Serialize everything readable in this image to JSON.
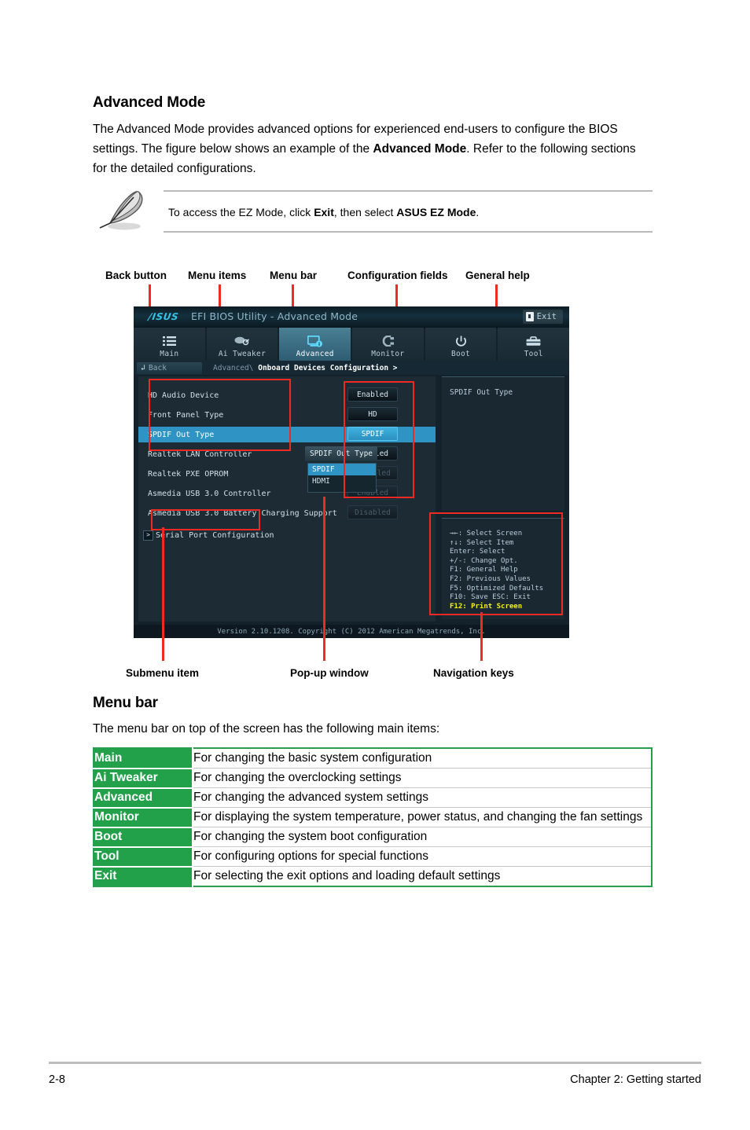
{
  "section": {
    "title": "Advanced Mode",
    "paragraph_1": "The Advanced Mode provides advanced options for experienced end-users to configure the BIOS settings. The figure below shows an example of the ",
    "paragraph_1_bold": "Advanced Mode",
    "paragraph_1_tail": ". Refer to the following sections for the detailed configurations."
  },
  "note": {
    "icon": "pencil-icon",
    "text_before": "To access the EZ Mode, click ",
    "bold_1": "Exit",
    "text_middle": ", then select ",
    "bold_2": "ASUS EZ Mode",
    "text_after": "."
  },
  "callouts": {
    "top": [
      {
        "label": "Back button"
      },
      {
        "label": "Menu items"
      },
      {
        "label": "Menu bar"
      },
      {
        "label": "Configuration fields"
      },
      {
        "label": "General help"
      }
    ],
    "bottom": [
      {
        "label": "Submenu item"
      },
      {
        "label": "Pop-up window"
      },
      {
        "label": "Navigation keys"
      }
    ],
    "line_color": "#ee2b22"
  },
  "bios": {
    "logo_text": "/ISUS",
    "title": "EFI BIOS Utility - Advanced Mode",
    "exit_label": "Exit",
    "exit_icon": "exit-door-icon",
    "tabs": [
      {
        "label": "Main",
        "icon": "list-icon",
        "active": false
      },
      {
        "label": "Ai Tweaker",
        "icon": "tuner-icon",
        "active": false
      },
      {
        "label": "Advanced",
        "icon": "monitor-info-icon",
        "active": true
      },
      {
        "label": "Monitor",
        "icon": "gauge-icon",
        "active": false
      },
      {
        "label": "Boot",
        "icon": "power-icon",
        "active": false
      },
      {
        "label": "Tool",
        "icon": "toolbox-icon",
        "active": false
      }
    ],
    "back_label": "Back",
    "back_icon": "back-arrow-icon",
    "breadcrumb_prefix": "Advanced\\",
    "breadcrumb_current": "Onboard Devices Configuration >",
    "options": [
      {
        "name": "HD Audio Device",
        "value": "Enabled",
        "state": "normal",
        "selected": false
      },
      {
        "name": "Front Panel Type",
        "value": "HD",
        "state": "normal",
        "selected": false
      },
      {
        "name": "SPDIF Out Type",
        "value": "SPDIF",
        "state": "active",
        "selected": true
      },
      {
        "name": "Realtek LAN Controller",
        "value": "Enabled",
        "state": "normal",
        "selected": false
      },
      {
        "name": "Realtek PXE OPROM",
        "value": "Disabled",
        "state": "dim",
        "selected": false
      },
      {
        "name": "Asmedia USB 3.0 Controller",
        "value": "Enabled",
        "state": "dim",
        "selected": false
      },
      {
        "name": "Asmedia USB 3.0 Battery Charging Support",
        "value": "Disabled",
        "state": "dim",
        "selected": false
      }
    ],
    "submenu": {
      "label": "Serial Port Configuration",
      "icon": "submenu-arrow-icon"
    },
    "popup": {
      "title": "SPDIF Out Type",
      "items": [
        {
          "label": "SPDIF",
          "selected": true
        },
        {
          "label": "HDMI",
          "selected": false
        }
      ]
    },
    "help": {
      "text": "SPDIF Out Type"
    },
    "navigation_keys": [
      {
        "text": "→←: Select Screen",
        "highlight": false
      },
      {
        "text": "↑↓: Select Item",
        "highlight": false
      },
      {
        "text": "Enter: Select",
        "highlight": false
      },
      {
        "text": "+/-: Change Opt.",
        "highlight": false
      },
      {
        "text": "F1: General Help",
        "highlight": false
      },
      {
        "text": "F2: Previous Values",
        "highlight": false
      },
      {
        "text": "F5: Optimized Defaults",
        "highlight": false
      },
      {
        "text": "F10: Save   ESC: Exit",
        "highlight": false
      },
      {
        "text": "F12: Print Screen",
        "highlight": true
      }
    ],
    "version_line": "Version 2.10.1208. Copyright (C) 2012 American Megatrends, Inc."
  },
  "menubar_section": {
    "title": "Menu bar",
    "intro": "The menu bar on top of the screen has the following main items:",
    "accent_color": "#22a04a",
    "rows": [
      {
        "key": "Main",
        "description": "For changing the basic system configuration"
      },
      {
        "key": "Ai Tweaker",
        "description": "For changing the overclocking settings"
      },
      {
        "key": "Advanced",
        "description": "For changing the advanced system settings"
      },
      {
        "key": "Monitor",
        "description": "For displaying the system temperature, power status, and changing the fan settings"
      },
      {
        "key": "Boot",
        "description": "For changing the system boot configuration"
      },
      {
        "key": "Tool",
        "description": "For configuring options for special functions"
      },
      {
        "key": "Exit",
        "description": "For selecting the exit options and loading default settings"
      }
    ]
  },
  "footer": {
    "page_number": "2-8",
    "chapter": "Chapter 2: Getting started"
  }
}
